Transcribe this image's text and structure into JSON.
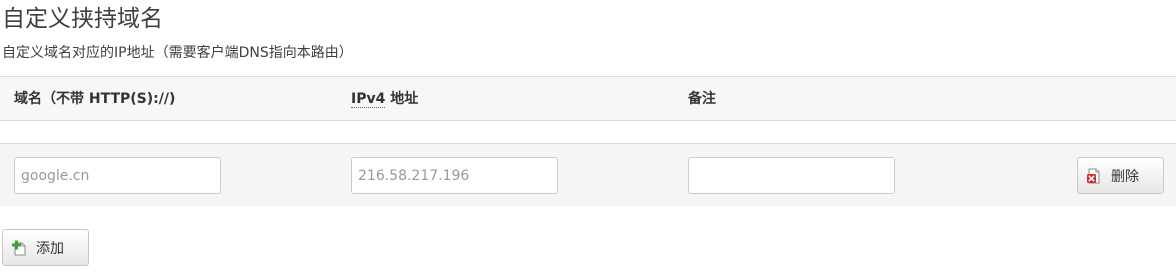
{
  "page": {
    "title": "自定义挟持域名",
    "description": "自定义域名对应的IP地址（需要客户端DNS指向本路由）"
  },
  "table": {
    "headers": {
      "domain": "域名（不带 HTTP(S)://)",
      "ipv4_abbr": "IPv4",
      "ipv4_rest": " 地址",
      "note": "备注"
    },
    "rows": [
      {
        "domain": "",
        "domain_placeholder": "google.cn",
        "ipv4": "",
        "ipv4_placeholder": "216.58.217.196",
        "note": "",
        "delete_label": "删除"
      }
    ]
  },
  "actions": {
    "add_label": "添加"
  },
  "icons": {
    "delete": "delete-icon",
    "add": "add-icon"
  },
  "colors": {
    "header_bg": "#f7f7f7",
    "row_bg": "#f5f5f5",
    "delete_icon": "#cc2222",
    "add_icon": "#3aa534"
  }
}
